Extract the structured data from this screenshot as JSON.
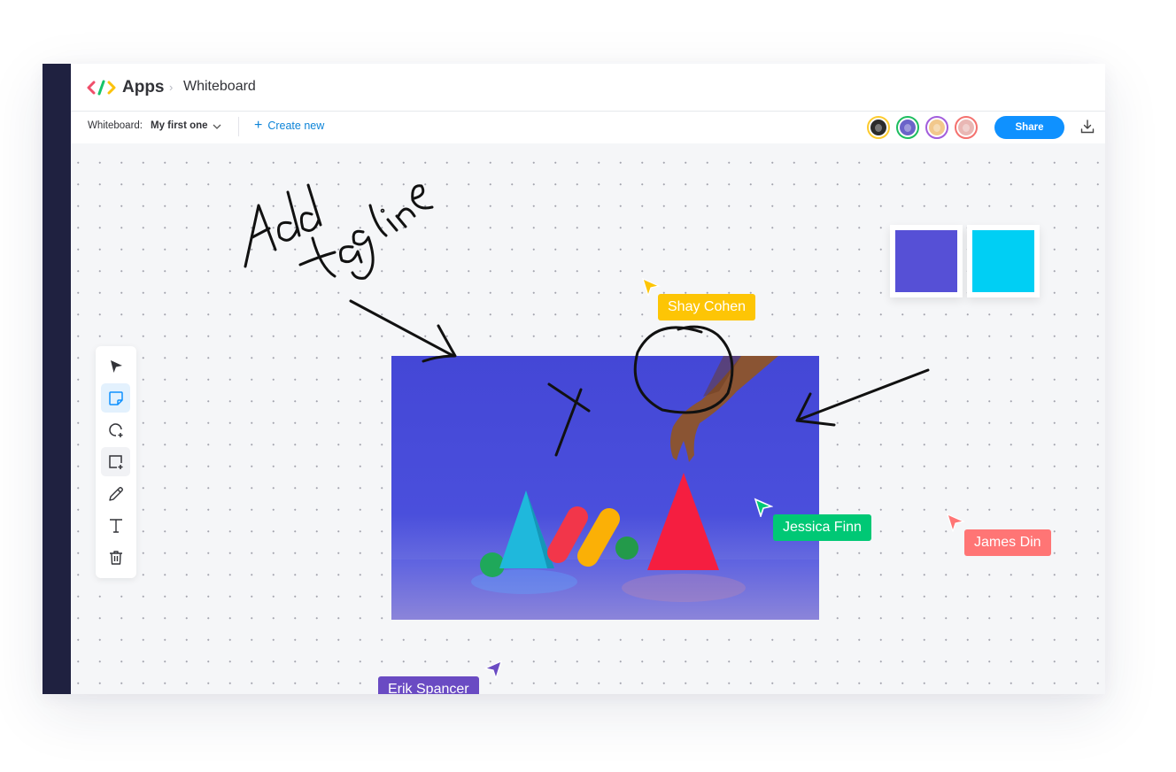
{
  "header": {
    "app_name": "Apps",
    "breadcrumb_separator": "›",
    "breadcrumb_current": "Whiteboard"
  },
  "subbar": {
    "whiteboard_label": "Whiteboard:",
    "whiteboard_value": "My first one",
    "create_new_label": "Create new",
    "share_label": "Share"
  },
  "collaborators": [
    {
      "name": "Collaborator 1",
      "ring_color": "#fdcb2e",
      "face_color": "#2b2b2b"
    },
    {
      "name": "Collaborator 2",
      "ring_color": "#1dbd5f",
      "face_color": "#6b63c9"
    },
    {
      "name": "Collaborator 3",
      "ring_color": "#a25ddc",
      "face_color": "#f2c88c"
    },
    {
      "name": "Collaborator 4",
      "ring_color": "#f4716e",
      "face_color": "#e9b7b4"
    }
  ],
  "toolbar": {
    "tools": [
      {
        "name": "select",
        "icon": "pointer-icon",
        "state": "default"
      },
      {
        "name": "sticky-note",
        "icon": "sticky-note-icon",
        "state": "active"
      },
      {
        "name": "shape-circle",
        "icon": "circle-add-icon",
        "state": "default"
      },
      {
        "name": "shape-rectangle",
        "icon": "rectangle-add-icon",
        "state": "hover"
      },
      {
        "name": "pen",
        "icon": "pencil-icon",
        "state": "default"
      },
      {
        "name": "text",
        "icon": "text-icon",
        "state": "default"
      },
      {
        "name": "delete",
        "icon": "trash-icon",
        "state": "default"
      }
    ]
  },
  "canvas": {
    "handwriting": [
      "Add",
      "tagline"
    ],
    "swatches": [
      {
        "color": "#5650d6"
      },
      {
        "color": "#00cff4"
      }
    ],
    "cursors": [
      {
        "user": "Shay Cohen",
        "color": "#fdc505"
      },
      {
        "user": "Jessica Finn",
        "color": "#00c875"
      },
      {
        "user": "James Din",
        "color": "#ff7575"
      },
      {
        "user": "Erik Spancer",
        "color": "#6a4bc3"
      }
    ]
  },
  "colors": {
    "rail": "#1f2140",
    "accent": "#0f91ff",
    "link": "#0d84d8"
  }
}
